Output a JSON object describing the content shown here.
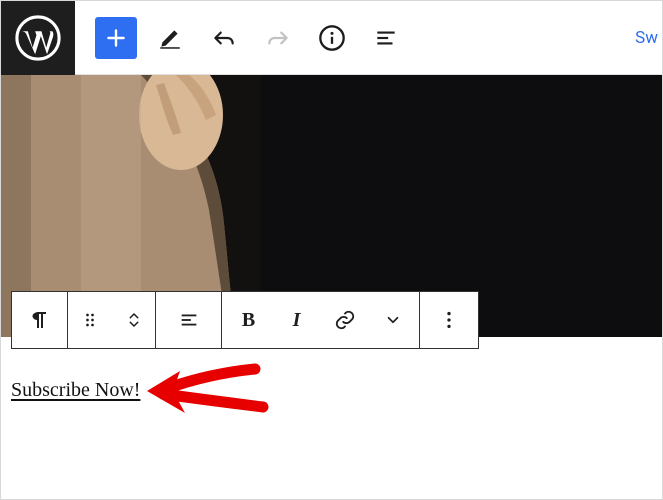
{
  "topbar": {
    "switch_label": "Sw"
  },
  "content": {
    "link_text": "Subscribe Now!"
  },
  "colors": {
    "accent": "#2e6ef0",
    "annotation": "#e60000"
  }
}
